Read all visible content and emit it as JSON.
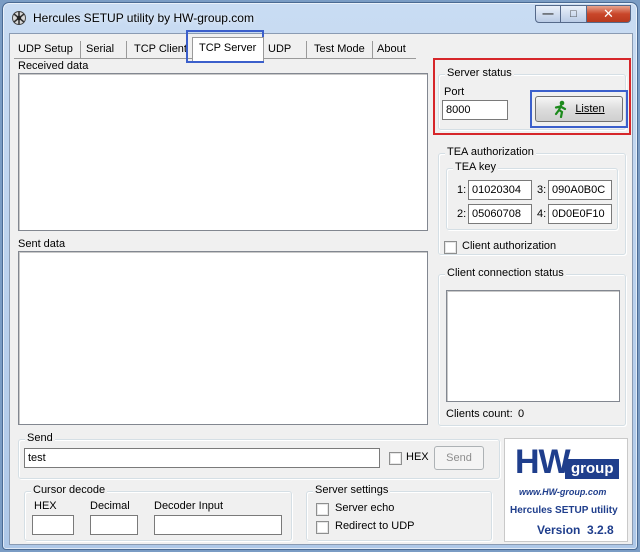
{
  "window": {
    "title": "Hercules SETUP utility by HW-group.com",
    "icons": [
      "app-icon",
      "minimize-icon",
      "maximize-icon",
      "close-icon"
    ]
  },
  "tabs": [
    {
      "label": "UDP Setup"
    },
    {
      "label": "Serial"
    },
    {
      "label": "TCP Client"
    },
    {
      "label": "TCP Server"
    },
    {
      "label": "UDP"
    },
    {
      "label": "Test Mode"
    },
    {
      "label": "About"
    }
  ],
  "active_tab": "TCP Server",
  "received": {
    "label": "Received data"
  },
  "sent": {
    "label": "Sent data"
  },
  "server_status": {
    "title": "Server status",
    "port_label": "Port",
    "port_value": "8000",
    "listen_label": "Listen",
    "listen_icon": "running-man-icon"
  },
  "tea": {
    "title": "TEA authorization",
    "key_title": "TEA key",
    "keys": [
      {
        "index": "1:",
        "value": "01020304"
      },
      {
        "index": "3:",
        "value": "090A0B0C"
      },
      {
        "index": "2:",
        "value": "05060708"
      },
      {
        "index": "4:",
        "value": "0D0E0F10"
      }
    ],
    "client_auth_label": "Client authorization"
  },
  "client_status": {
    "title": "Client connection status",
    "clients_count_label": "Clients count:",
    "clients_count_value": "0"
  },
  "send": {
    "title": "Send",
    "value": "test",
    "hex_label": "HEX",
    "send_button": "Send"
  },
  "cursor_decode": {
    "title": "Cursor decode",
    "hex_label": "HEX",
    "decimal_label": "Decimal",
    "decoder_label": "Decoder Input"
  },
  "server_settings": {
    "title": "Server settings",
    "echo_label": "Server echo",
    "redirect_label": "Redirect to UDP"
  },
  "logo": {
    "hw": "HW",
    "group": "group",
    "url": "www.HW-group.com",
    "product": "Hercules SETUP utility",
    "version": "Version  3.2.8"
  },
  "colors": {
    "highlight_blue": "#3b5fcb",
    "highlight_red": "#d6262a",
    "logo_blue": "#1f3e8c"
  }
}
